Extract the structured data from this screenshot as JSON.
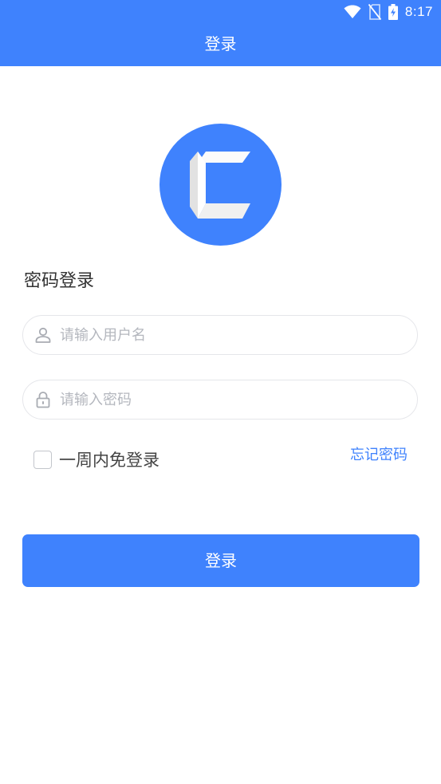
{
  "status_bar": {
    "time": "8:17",
    "icons": [
      "wifi-icon",
      "no-sim-icon",
      "battery-charging-icon"
    ]
  },
  "app_bar": {
    "title": "登录"
  },
  "login": {
    "section_title": "密码登录",
    "username": {
      "value": "",
      "placeholder": "请输入用户名",
      "icon": "user-icon"
    },
    "password": {
      "value": "",
      "placeholder": "请输入密码",
      "icon": "lock-icon"
    },
    "remember": {
      "label": "一周内免登录",
      "checked": false
    },
    "forgot_label": "忘记密码",
    "submit_label": "登录"
  },
  "colors": {
    "primary": "#3f82fd",
    "logo_letter": "#f2f2f2",
    "field_border": "#e5e6ea",
    "placeholder": "#b4b7be"
  }
}
